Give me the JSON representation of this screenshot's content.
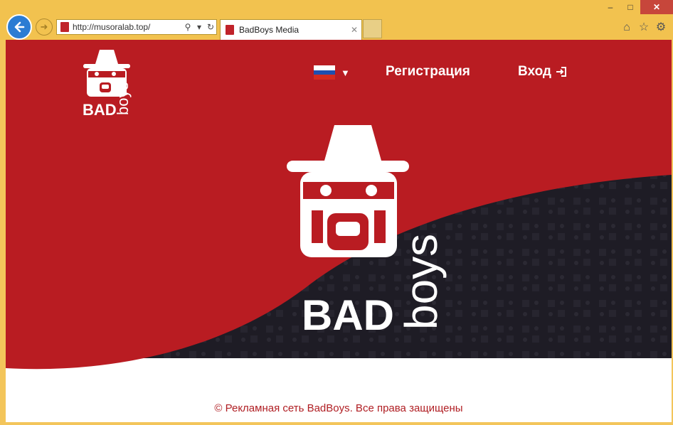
{
  "browser": {
    "address": "http://musoralab.top/",
    "tab_title": "BadBoys Media",
    "window_controls": [
      "minimize",
      "maximize",
      "close"
    ]
  },
  "header": {
    "language_flag": "russia-flag",
    "register_label": "Регистрация",
    "login_label": "Вход"
  },
  "logo": {
    "bad": "BAD",
    "boys": "boys"
  },
  "footer": {
    "copyright": "© Рекламная сеть BadBoys. Все права защищены"
  },
  "colors": {
    "brand_red": "#b91c22",
    "dark_band": "#1e1c25",
    "browser_frame": "#f2c24f"
  }
}
